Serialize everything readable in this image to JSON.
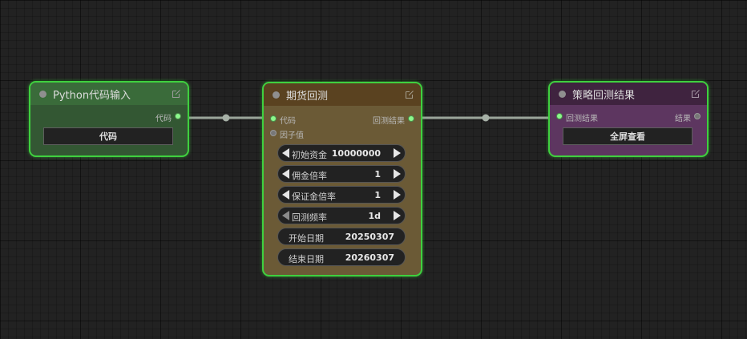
{
  "nodes": {
    "python": {
      "title": "Python代码输入",
      "outputs": [
        "代码"
      ],
      "button_label": "代码"
    },
    "backtest": {
      "title": "期货回测",
      "inputs": [
        "代码",
        "因子值"
      ],
      "outputs": [
        "回测结果"
      ],
      "widgets": [
        {
          "label": "初始资金",
          "value": "10000000"
        },
        {
          "label": "佣金倍率",
          "value": "1"
        },
        {
          "label": "保证金倍率",
          "value": "1"
        },
        {
          "label": "回测频率",
          "value": "1d"
        },
        {
          "label": "开始日期",
          "value": "20250307"
        },
        {
          "label": "结束日期",
          "value": "20260307"
        }
      ]
    },
    "result": {
      "title": "策略回测结果",
      "inputs": [
        "回测结果"
      ],
      "outputs": [
        "结果"
      ],
      "button_label": "全屏查看"
    }
  },
  "colors": {
    "selection_outline": "#3fd03f",
    "link": "#9aa59a",
    "connected_slot": "#8cf88c"
  },
  "icons": {
    "node_edit": "edit-icon",
    "node_status": "status-dot-icon"
  }
}
